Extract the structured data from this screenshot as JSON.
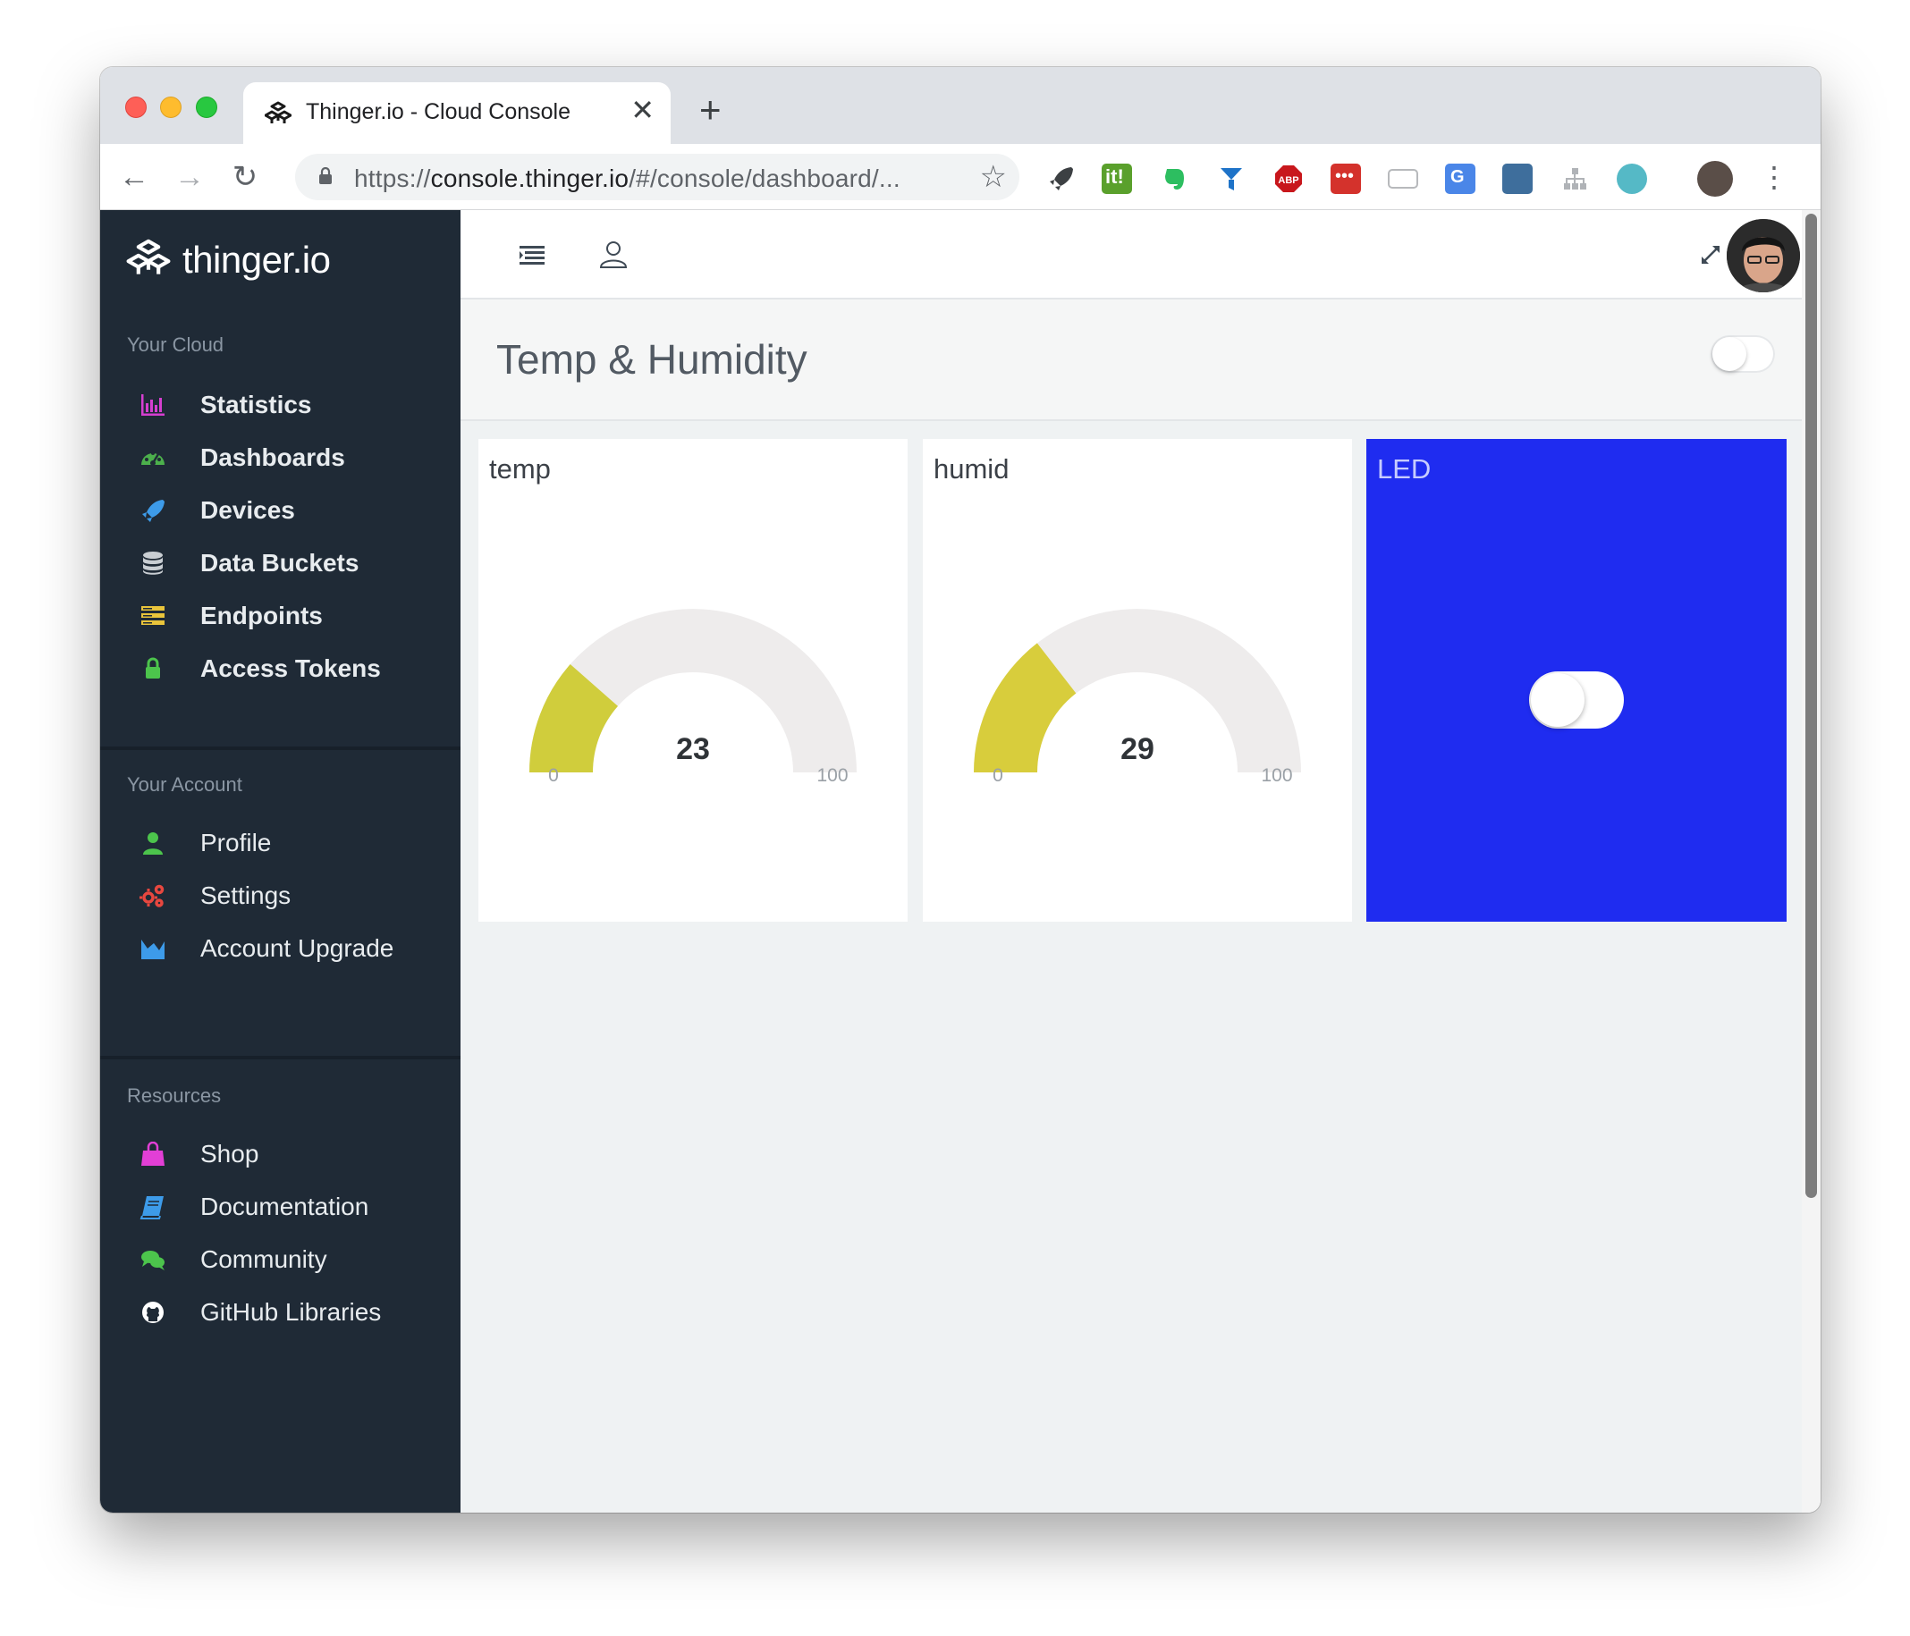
{
  "browser": {
    "tab_title": "Thinger.io - Cloud Console",
    "url_scheme": "https://",
    "url_host": "console.thinger.io",
    "url_path": "/#/console/dashboard/..."
  },
  "sidebar": {
    "brand": "thinger.io",
    "sections": [
      {
        "title": "Your Cloud"
      },
      {
        "title": "Your Account"
      },
      {
        "title": "Resources"
      }
    ],
    "cloud_items": [
      {
        "label": "Statistics",
        "icon": "bar-chart-icon",
        "color": "#d63fd0"
      },
      {
        "label": "Dashboards",
        "icon": "dashboard-icon",
        "color": "#4cb04c"
      },
      {
        "label": "Devices",
        "icon": "rocket-icon",
        "color": "#3d9be9"
      },
      {
        "label": "Data Buckets",
        "icon": "database-icon",
        "color": "#c9ced3"
      },
      {
        "label": "Endpoints",
        "icon": "server-icon",
        "color": "#e9c43b"
      },
      {
        "label": "Access Tokens",
        "icon": "lock-icon",
        "color": "#4cc44c"
      }
    ],
    "account_items": [
      {
        "label": "Profile",
        "icon": "user-icon",
        "color": "#4cc44c"
      },
      {
        "label": "Settings",
        "icon": "cogs-icon",
        "color": "#e8473f"
      },
      {
        "label": "Account Upgrade",
        "icon": "area-chart-icon",
        "color": "#3d9be9"
      }
    ],
    "resource_items": [
      {
        "label": "Shop",
        "icon": "shopping-bag-icon",
        "color": "#e23fd6"
      },
      {
        "label": "Documentation",
        "icon": "book-icon",
        "color": "#3d9be9"
      },
      {
        "label": "Community",
        "icon": "comments-icon",
        "color": "#4cc44c"
      },
      {
        "label": "GitHub Libraries",
        "icon": "github-icon",
        "color": "#ffffff"
      }
    ]
  },
  "dashboard": {
    "title": "Temp & Humidity",
    "widgets": [
      {
        "title": "temp",
        "type": "gauge",
        "value": "23",
        "min": "0",
        "max": "100",
        "fill_color": "#d0cd3c"
      },
      {
        "title": "humid",
        "type": "gauge",
        "value": "29",
        "min": "0",
        "max": "100",
        "fill_color": "#d8cd3c"
      },
      {
        "title": "LED",
        "type": "switch",
        "background": "#1f2cf0",
        "state": "off"
      }
    ]
  }
}
